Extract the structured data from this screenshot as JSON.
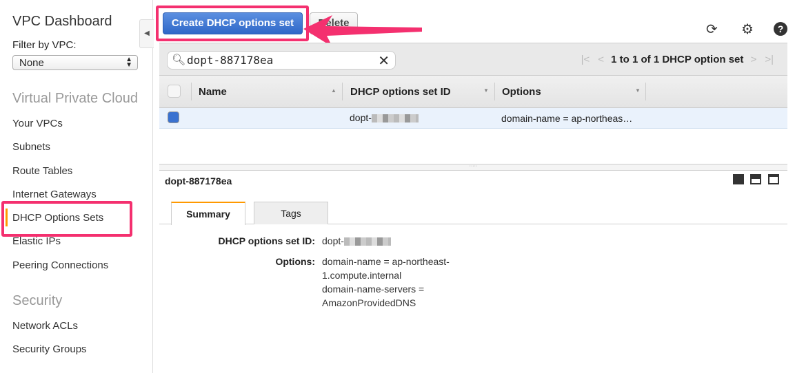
{
  "sidebar": {
    "title": "VPC Dashboard",
    "filter_label": "Filter by VPC:",
    "filter_value": "None",
    "sections": [
      {
        "title": "Virtual Private Cloud"
      },
      {
        "title": "Security"
      }
    ],
    "items": [
      "Your VPCs",
      "Subnets",
      "Route Tables",
      "Internet Gateways",
      "DHCP Options Sets",
      "Elastic IPs",
      "Peering Connections",
      "Network ACLs",
      "Security Groups"
    ]
  },
  "toolbar": {
    "create_label": "Create DHCP options set",
    "delete_label": "Delete"
  },
  "search": {
    "value": "dopt-887178ea"
  },
  "pager": {
    "text": "1 to 1 of 1 DHCP option set"
  },
  "table": {
    "columns": [
      "Name",
      "DHCP options set ID",
      "Options"
    ],
    "rows": [
      {
        "name": "",
        "id": "dopt-",
        "options": "domain-name = ap-northeas…"
      }
    ]
  },
  "details": {
    "title": "dopt-887178ea",
    "tabs": [
      "Summary",
      "Tags"
    ],
    "id_label": "DHCP options set ID:",
    "id_value": "dopt-",
    "options_label": "Options:",
    "options_lines": [
      "domain-name = ap-northeast-",
      "1.compute.internal",
      "domain-name-servers =",
      "AmazonProvidedDNS"
    ]
  },
  "colors": {
    "highlight": "#f4306f",
    "primary": "#3a72d0",
    "selected_row": "#eaf2fc"
  }
}
